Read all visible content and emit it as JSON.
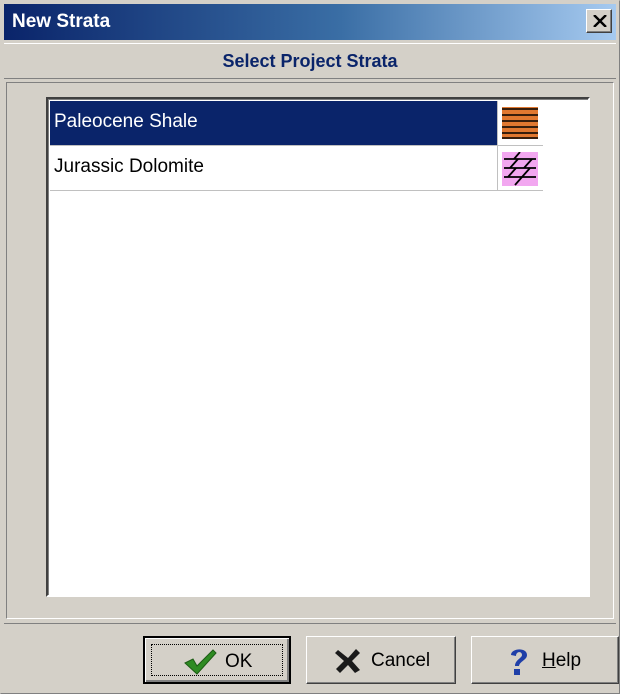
{
  "window": {
    "title": "New Strata",
    "close_label": "×"
  },
  "header": {
    "title": "Select Project Strata"
  },
  "strata_list": {
    "items": [
      {
        "name": "Paleocene Shale",
        "pattern": "shale-pattern",
        "pattern_color": "#e07830",
        "selected": true
      },
      {
        "name": "Jurassic Dolomite",
        "pattern": "dolomite-pattern",
        "pattern_color": "#f2a7f0",
        "selected": false
      }
    ]
  },
  "buttons": {
    "ok": {
      "label": "OK",
      "icon": "checkmark-icon",
      "color": "#2e8b22"
    },
    "cancel": {
      "label": "Cancel",
      "icon": "x-icon",
      "color": "#1a1a1a"
    },
    "help": {
      "label_first": "H",
      "label_rest": "elp",
      "icon": "question-mark-icon",
      "color": "#1f3fa8"
    }
  },
  "colors": {
    "selection": "#0a246a",
    "title_gradient_start": "#0a246a",
    "title_gradient_end": "#a6caf0",
    "face": "#d4d0c8"
  }
}
